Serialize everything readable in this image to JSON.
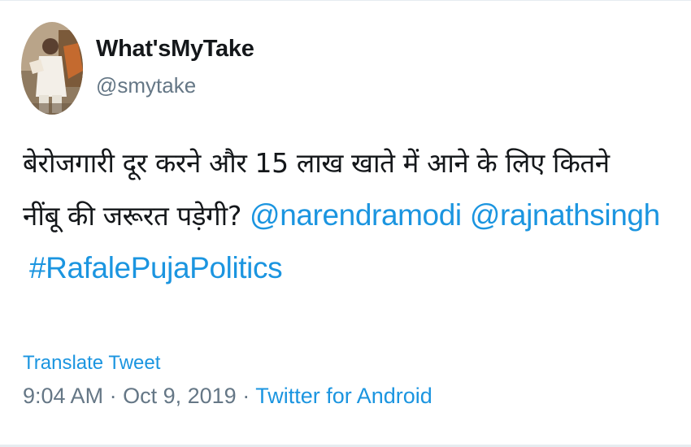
{
  "tweet": {
    "author": {
      "display_name": "What'sMyTake",
      "handle": "@smytake"
    },
    "body": {
      "line1": "बेरोजगारी दूर करने और 15 लाख खाते में आने के लिए कितने",
      "line2_text": "नींबू की जरूरत पड़ेगी?",
      "mentions": [
        "@narendramodi",
        "@rajnathsingh"
      ],
      "hashtag": "#RafalePujaPolitics"
    },
    "translate_label": "Translate Tweet",
    "time": "9:04 AM",
    "date": "Oct 9, 2019",
    "separator": "·",
    "source": "Twitter for Android"
  },
  "colors": {
    "link": "#1b95e0",
    "secondary_text": "#657786",
    "primary_text": "#14171a",
    "divider": "#e6ecf0"
  }
}
